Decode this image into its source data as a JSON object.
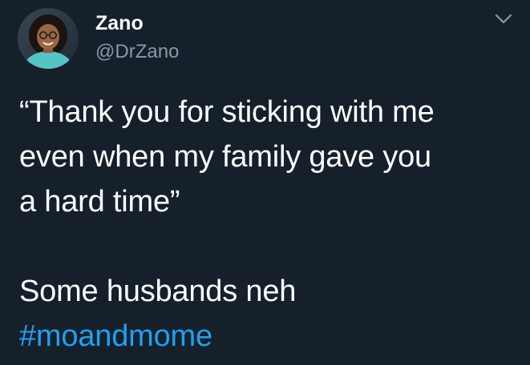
{
  "tweet": {
    "author": {
      "name": "Zano",
      "handle": "@DrZano"
    },
    "menu_icon": "chevron-down-icon",
    "text_lines": [
      "“Thank you for sticking with me",
      "even when my family gave you",
      "a hard time”"
    ],
    "closing_line": "Some husbands neh",
    "hashtag": "#moandmome"
  },
  "colors": {
    "background": "#15202b",
    "text": "#ffffff",
    "secondary_text": "#8899a6",
    "link": "#1da1f2"
  }
}
